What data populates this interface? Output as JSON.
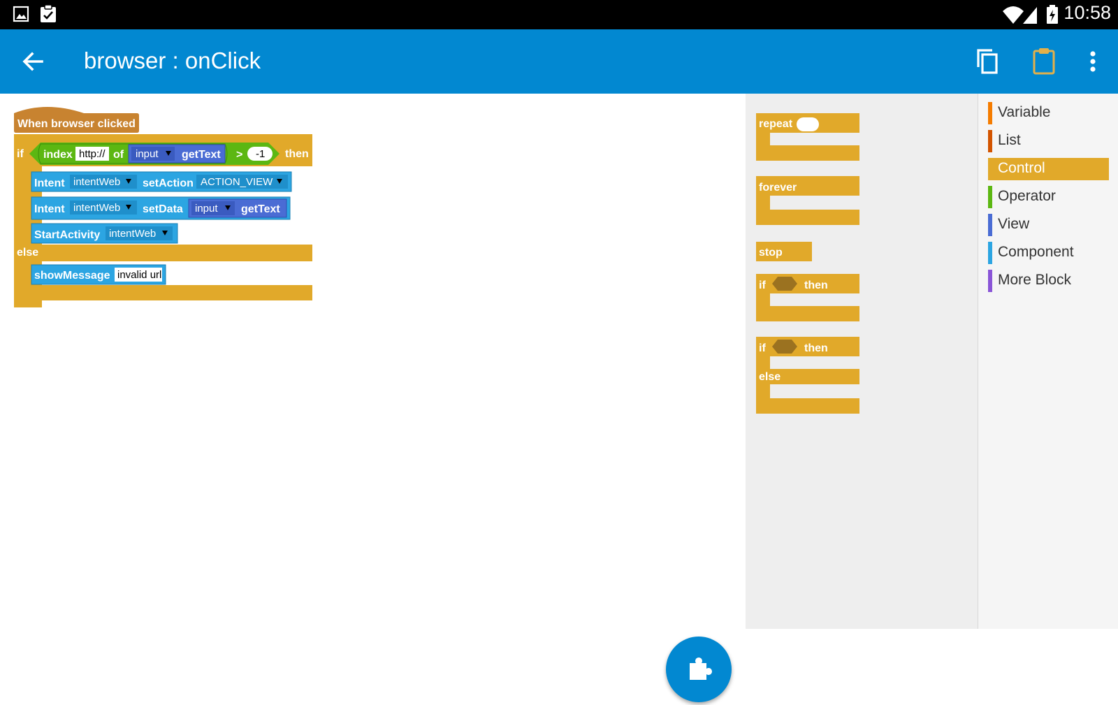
{
  "status_bar": {
    "time": "10:58",
    "icons": [
      "image-icon",
      "clipboard-check-icon",
      "wifi-icon",
      "signal-icon",
      "battery-icon"
    ]
  },
  "app_bar": {
    "title": "browser : onClick",
    "back_icon": "arrow-back-icon",
    "actions": [
      "copy-icon",
      "paste-icon",
      "more-vert-icon"
    ],
    "color": "#0288d1"
  },
  "editor": {
    "event_block": "When browser clicked",
    "if_block": {
      "if_label": "if",
      "index_label": "index",
      "index_text": "http://",
      "of_label": "of",
      "view_name": "input",
      "get_text_label": "getText",
      "compare_op": ">",
      "compare_value": "-1",
      "then_label": "then"
    },
    "intent_set_action": {
      "intent_label": "Intent",
      "intent_var": "intentWeb",
      "method_label": "setAction",
      "action_value": "ACTION_VIEW"
    },
    "intent_set_data": {
      "intent_label": "Intent",
      "intent_var": "intentWeb",
      "method_label": "setData",
      "view_name": "input",
      "get_text_label": "getText"
    },
    "start_activity": {
      "label": "StartActivity",
      "intent_var": "intentWeb"
    },
    "else_label": "else",
    "show_message": {
      "label": "showMessage",
      "text": "invalid url"
    }
  },
  "palette": {
    "repeat_label": "repeat",
    "forever_label": "forever",
    "stop_label": "stop",
    "if_then": {
      "if_label": "if",
      "then_label": "then"
    },
    "if_then_else": {
      "if_label": "if",
      "then_label": "then",
      "else_label": "else"
    }
  },
  "categories": [
    {
      "label": "Variable",
      "color": "#f57c00",
      "selected": false
    },
    {
      "label": "List",
      "color": "#d35400",
      "selected": false
    },
    {
      "label": "Control",
      "color": "#e1a92a",
      "selected": true
    },
    {
      "label": "Operator",
      "color": "#5cb712",
      "selected": false
    },
    {
      "label": "View",
      "color": "#4a6cd4",
      "selected": false
    },
    {
      "label": "Component",
      "color": "#2ca5e2",
      "selected": false
    },
    {
      "label": "More Block",
      "color": "#8a55d7",
      "selected": false
    }
  ],
  "colors": {
    "control": "#e1a92a",
    "event": "#c88330",
    "operator": "#5cb712",
    "view": "#4a6cd4",
    "component": "#2ca5e2",
    "accent": "#0288d1"
  },
  "fab": {
    "icon": "puzzle-piece-icon"
  }
}
